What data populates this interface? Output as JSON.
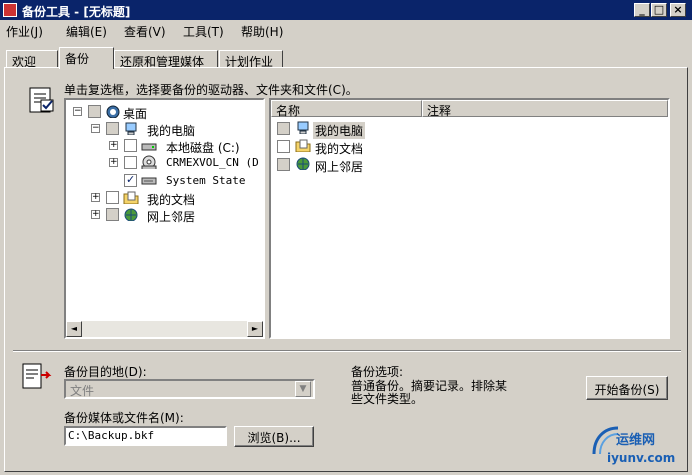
{
  "window": {
    "title": "备份工具 - [无标题]",
    "min_glyph": "_",
    "max_glyph": "□",
    "close_glyph": "×"
  },
  "menu": [
    "作业(J)",
    "编辑(E)",
    "查看(V)",
    "工具(T)",
    "帮助(H)"
  ],
  "tabs": [
    "欢迎",
    "备份",
    "还原和管理媒体",
    "计划作业"
  ],
  "active_tab": "备份",
  "instruction": "单击复选框，选择要备份的驱动器、文件夹和文件(C)。",
  "tree": {
    "expander_minus": "−",
    "expander_plus": "+",
    "items": [
      {
        "label": "桌面",
        "checked": false,
        "icon": "desktop-icon"
      },
      {
        "label": "我的电脑",
        "checked": false,
        "icon": "computer-icon"
      },
      {
        "label": "本地磁盘 (C:)",
        "checked": false,
        "icon": "disk-icon"
      },
      {
        "label": "CRMEXVOL_CN (D",
        "checked": false,
        "icon": "cdrom-icon"
      },
      {
        "label": "System State",
        "checked": true,
        "icon": "system-state-icon"
      },
      {
        "label": "我的文档",
        "checked": false,
        "icon": "documents-icon"
      },
      {
        "label": "网上邻居",
        "checked": false,
        "icon": "network-icon"
      }
    ],
    "scroll_left": "◄",
    "scroll_right": "►"
  },
  "list": {
    "columns": [
      "名称",
      "注释"
    ],
    "rows": [
      {
        "name": "我的电脑",
        "icon": "computer-icon"
      },
      {
        "name": "我的文档",
        "icon": "documents-icon"
      },
      {
        "name": "网上邻居",
        "icon": "network-icon"
      }
    ]
  },
  "destination": {
    "label": "备份目的地(D):",
    "value": "文件",
    "arrow": "▼"
  },
  "media": {
    "label": "备份媒体或文件名(M):",
    "value": "C:\\Backup.bkf",
    "browse_label": "浏览(B)..."
  },
  "options": {
    "heading": "备份选项:",
    "text_line1": "普通备份。摘要记录。排除某",
    "text_line2": "些文件类型。"
  },
  "start_button": "开始备份(S)",
  "watermark": {
    "text_top": "运维网",
    "text_bottom": "iyunv.com"
  },
  "colors": {
    "title_bar": "#0a246a",
    "face": "#d4d0c8",
    "check": "#0a246a",
    "watermark": "#1a5fb4"
  }
}
